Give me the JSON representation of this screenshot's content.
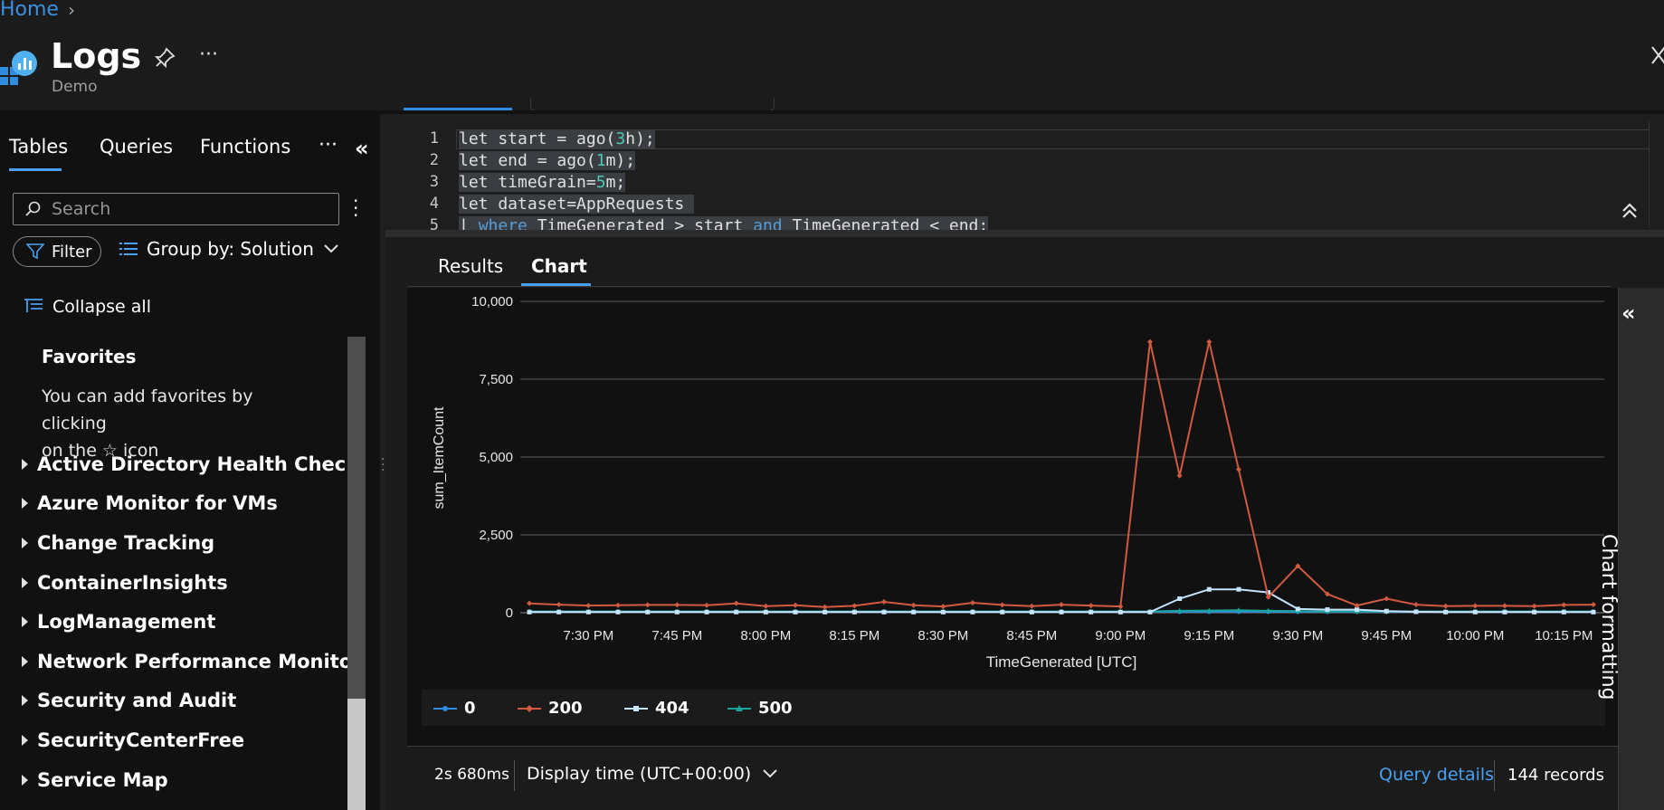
{
  "breadcrumb": {
    "home": "Home"
  },
  "header": {
    "title": "Logs",
    "subtitle": "Demo"
  },
  "left_pane": {
    "tabs": [
      "Tables",
      "Queries",
      "Functions"
    ],
    "search_placeholder": "Search",
    "filter_label": "Filter",
    "group_by_label": "Group by: Solution",
    "collapse_all": "Collapse all",
    "favorites": {
      "title": "Favorites",
      "text_line1": "You can add favorites by clicking",
      "text_line2": "on the ☆ icon"
    },
    "tree_items": [
      "Active Directory Health Check",
      "Azure Monitor for VMs",
      "Change Tracking",
      "ContainerInsights",
      "LogManagement",
      "Network Performance Monitor",
      "Security and Audit",
      "SecurityCenterFree",
      "Service Map"
    ]
  },
  "editor": {
    "line_numbers": [
      "1",
      "2",
      "3",
      "4",
      "5"
    ],
    "lines": [
      "let start = ago(3h);",
      "let end = ago(1m);",
      "let timeGrain=5m;",
      "let dataset=AppRequests",
      "| where TimeGenerated > start and TimeGenerated < end;"
    ]
  },
  "results": {
    "tabs": [
      "Results",
      "Chart"
    ],
    "active_tab": "Chart",
    "chart_formatting_label": "Chart formatting",
    "footer": {
      "duration": "2s 680ms",
      "display_time": "Display time (UTC+00:00)",
      "query_details": "Query details",
      "records": "144 records"
    }
  },
  "colors": {
    "accent": "#4aa0f0",
    "s0": "#2e8ddf",
    "s200": "#d05a3f",
    "s404": "#c6e3ff",
    "s500": "#1ba39c"
  },
  "chart_data": {
    "type": "line",
    "xlabel": "TimeGenerated [UTC]",
    "ylabel": "sum_ItemCount",
    "ylim": [
      0,
      10000
    ],
    "yticks": [
      "10,000",
      "7,500",
      "5,000",
      "2,500",
      "0"
    ],
    "xtick_labels": [
      "7:30 PM",
      "7:45 PM",
      "8:00 PM",
      "8:15 PM",
      "8:30 PM",
      "8:45 PM",
      "9:00 PM",
      "9:15 PM",
      "9:30 PM",
      "9:45 PM",
      "10:00 PM",
      "10:15 PM"
    ],
    "x": [
      "7:20 PM",
      "7:25 PM",
      "7:30 PM",
      "7:35 PM",
      "7:40 PM",
      "7:45 PM",
      "7:50 PM",
      "7:55 PM",
      "8:00 PM",
      "8:05 PM",
      "8:10 PM",
      "8:15 PM",
      "8:20 PM",
      "8:25 PM",
      "8:30 PM",
      "8:35 PM",
      "8:40 PM",
      "8:45 PM",
      "8:50 PM",
      "8:55 PM",
      "9:00 PM",
      "9:05 PM",
      "9:10 PM",
      "9:15 PM",
      "9:20 PM",
      "9:25 PM",
      "9:30 PM",
      "9:35 PM",
      "9:40 PM",
      "9:45 PM",
      "9:50 PM",
      "9:55 PM",
      "10:00 PM",
      "10:05 PM",
      "10:10 PM",
      "10:15 PM",
      "10:20 PM"
    ],
    "grid": true,
    "legend_position": "bottom",
    "series": [
      {
        "name": "0",
        "values": [
          30,
          30,
          30,
          30,
          30,
          30,
          30,
          30,
          30,
          30,
          30,
          30,
          30,
          30,
          30,
          30,
          30,
          30,
          30,
          30,
          30,
          30,
          30,
          30,
          30,
          30,
          30,
          30,
          30,
          30,
          30,
          30,
          30,
          30,
          30,
          30,
          30
        ]
      },
      {
        "name": "200",
        "values": [
          300,
          260,
          230,
          240,
          250,
          250,
          240,
          300,
          210,
          240,
          180,
          220,
          350,
          240,
          200,
          320,
          250,
          210,
          260,
          230,
          200,
          8700,
          4400,
          8700,
          4600,
          500,
          1500,
          600,
          230,
          450,
          260,
          210,
          220,
          220,
          210,
          250,
          260
        ]
      },
      {
        "name": "404",
        "values": [
          20,
          20,
          20,
          20,
          20,
          20,
          20,
          20,
          20,
          20,
          20,
          20,
          20,
          20,
          20,
          20,
          20,
          20,
          20,
          20,
          20,
          20,
          450,
          750,
          750,
          650,
          120,
          100,
          100,
          50,
          30,
          20,
          20,
          20,
          20,
          20,
          20
        ]
      },
      {
        "name": "500",
        "values": [
          40,
          40,
          40,
          40,
          40,
          40,
          40,
          40,
          40,
          40,
          40,
          40,
          40,
          40,
          40,
          40,
          40,
          40,
          40,
          40,
          40,
          40,
          60,
          70,
          80,
          60,
          50,
          40,
          40,
          40,
          40,
          40,
          40,
          40,
          40,
          40,
          40
        ]
      }
    ]
  }
}
